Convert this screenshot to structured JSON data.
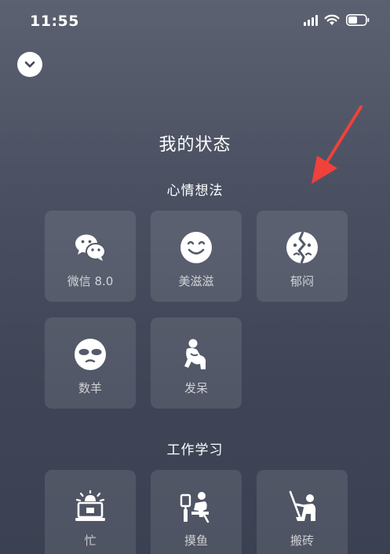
{
  "status_bar": {
    "time": "11:55"
  },
  "page": {
    "title": "我的状态"
  },
  "sections": [
    {
      "title": "心情想法",
      "items": [
        {
          "label": "微信 8.0",
          "icon": "wechat-icon"
        },
        {
          "label": "美滋滋",
          "icon": "smile-face-icon"
        },
        {
          "label": "郁闷",
          "icon": "broken-face-icon"
        },
        {
          "label": "数羊",
          "icon": "sheep-face-icon"
        },
        {
          "label": "发呆",
          "icon": "daze-figure-icon"
        }
      ]
    },
    {
      "title": "工作学习",
      "items": [
        {
          "label": "忙",
          "icon": "alarm-laptop-icon"
        },
        {
          "label": "摸鱼",
          "icon": "slacking-icon"
        },
        {
          "label": "搬砖",
          "icon": "digging-icon"
        }
      ]
    }
  ],
  "colors": {
    "annotation_arrow": "#f0413a",
    "tile_bg": "rgba(255,255,255,0.10)"
  }
}
